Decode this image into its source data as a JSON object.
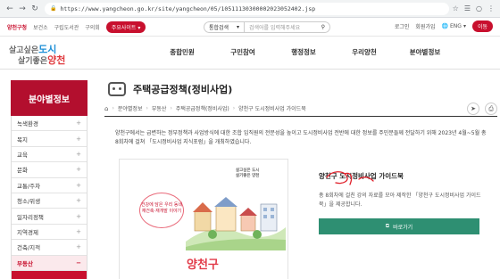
{
  "browser": {
    "url": "https://www.yangcheon.go.kr/site/yangcheon/05/10511130300002023052402.jsp"
  },
  "utility_bar": {
    "links": [
      {
        "label": "양천구청",
        "active": true
      },
      {
        "label": "보건소",
        "active": false
      },
      {
        "label": "구립도서관",
        "active": false
      },
      {
        "label": "구의회",
        "active": false
      }
    ],
    "site_menu_label": "주요사이트",
    "search_type": "통합검색",
    "search_placeholder": "검색어를 입력해주세요",
    "login_label": "로그인",
    "join_label": "회원가입",
    "lang_label": "ENG",
    "cta_label": "이동"
  },
  "header": {
    "logo_line1_prefix": "살고싶은",
    "logo_line1_emph": "도시",
    "logo_line2_prefix": "살기좋은",
    "logo_line2_emph": "양천",
    "gnb": [
      "종합민원",
      "구민참여",
      "행정정보",
      "우리양천",
      "분야별정보"
    ]
  },
  "sidebar": {
    "title": "분야별정보",
    "items": [
      {
        "label": "녹색환경",
        "active": false
      },
      {
        "label": "복지",
        "active": false
      },
      {
        "label": "교육",
        "active": false
      },
      {
        "label": "문화",
        "active": false
      },
      {
        "label": "교통/주차",
        "active": false
      },
      {
        "label": "청소/위생",
        "active": false
      },
      {
        "label": "일자리정책",
        "active": false
      },
      {
        "label": "지역경제",
        "active": false
      },
      {
        "label": "건축/지적",
        "active": false
      },
      {
        "label": "부동산",
        "active": true
      }
    ]
  },
  "content": {
    "page_title": "주택공급정책(정비사업)",
    "breadcrumb": [
      "분야별정보",
      "부동산",
      "주택공급정책(정비사업)",
      "양천구 도시정비사업 가이드북"
    ],
    "intro": "양천구에서는 급변하는 정부정책과 사업방식에 대한 조합 임직원의 전문성을 높이고 도시정비사업 전반에 대한 정보를 주민분들께 전달하기 위해 2023년 4월~5월 총 8회차에 걸쳐 「도시정비사업 지식포럼」을 개최하였습니다.",
    "card": {
      "logo_line1": "살고싶은 도시",
      "logo_line2": "살기좋은 양천",
      "bubble_text": "건강에 담은 우리 동네 재건축·재개발 이야기",
      "bottom_text": "양천구"
    },
    "guide": {
      "title": "양천구 도시정비사업 가이드북",
      "description": "총 8회차에 걸친 강의 자료를 모아 제작한 「양천구 도시정비사업 가이드북」을 제공합니다.",
      "button_label": "바로가기"
    }
  },
  "colors": {
    "brand_red": "#c8102e",
    "sidebar_title": "#b30f2e",
    "view_button": "#2e8f72"
  }
}
